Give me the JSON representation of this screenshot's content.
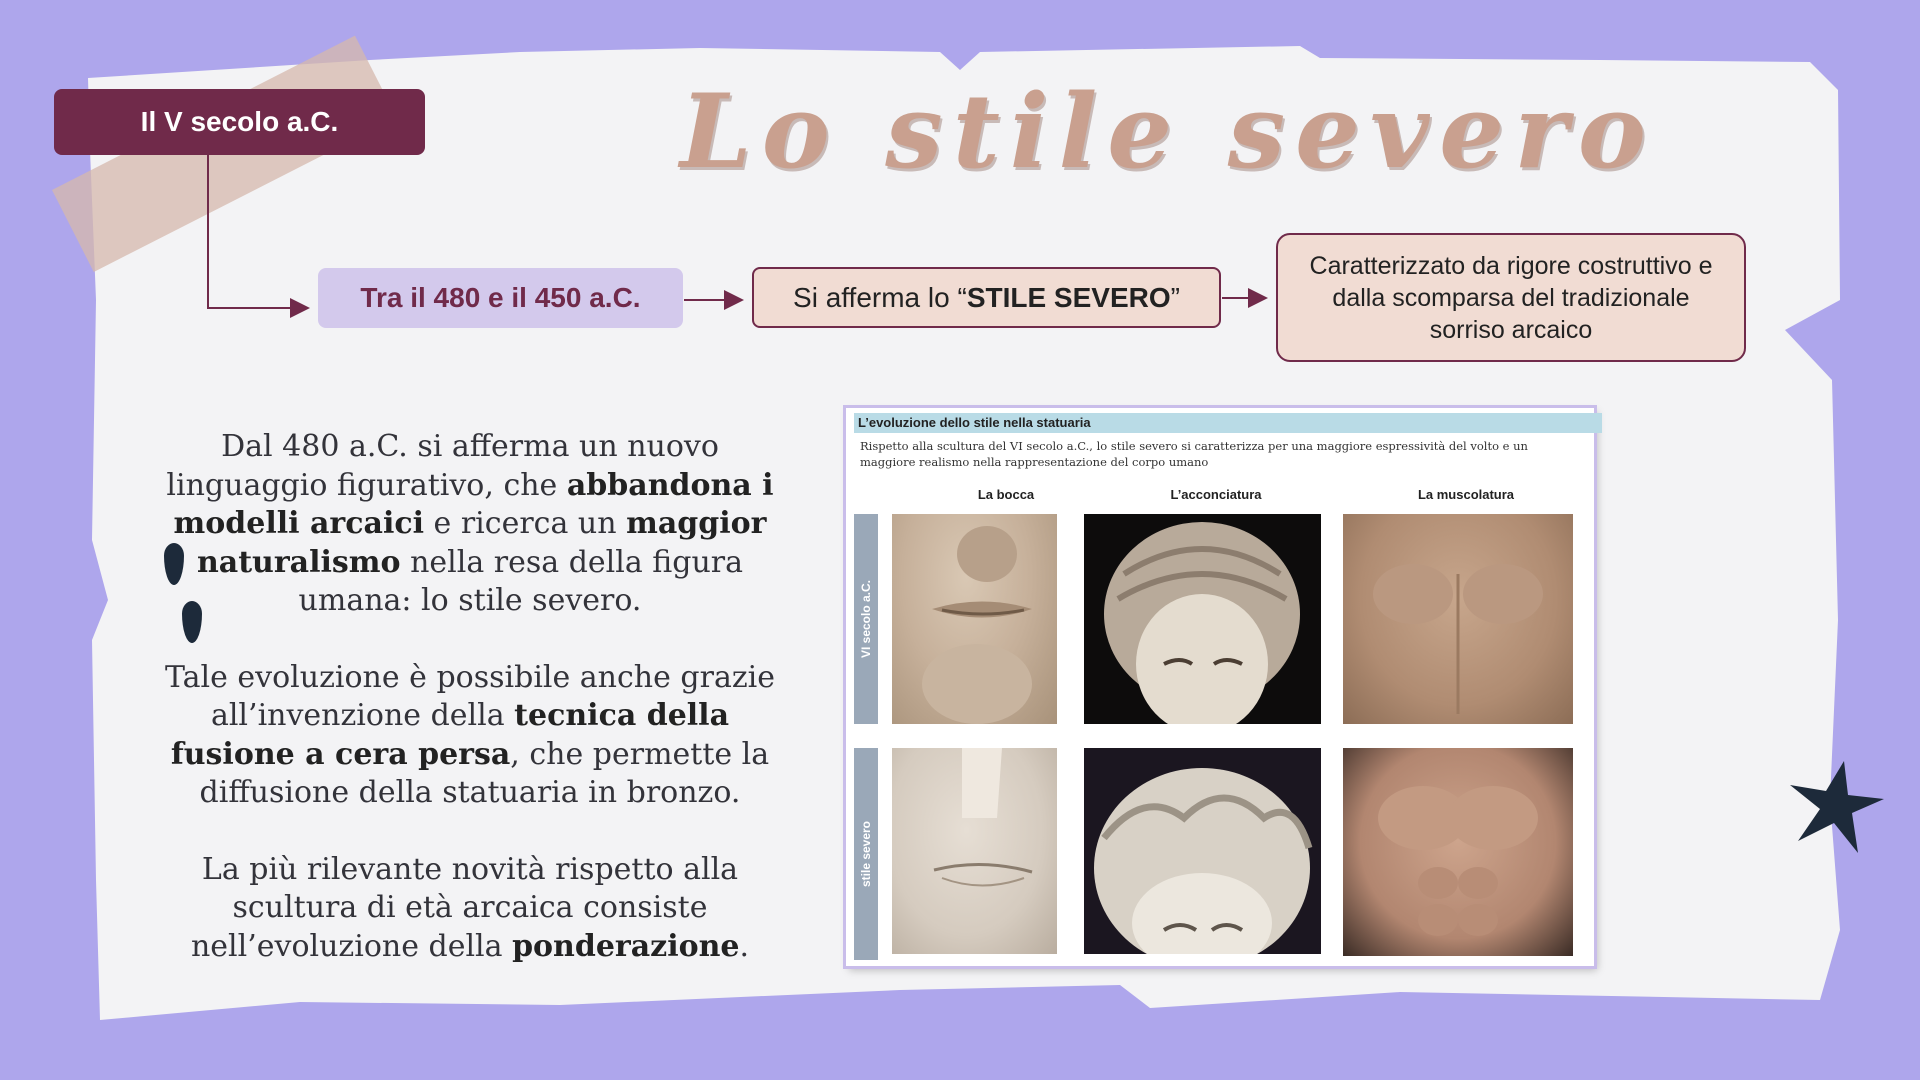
{
  "period_label": "Il V secolo a.C.",
  "title": "Lo stile severo",
  "timeline": {
    "date_range": "Tra il 480 e il 450 a.C.",
    "affirm_prefix": "Si afferma lo “",
    "affirm_bold": "STILE SEVERO",
    "affirm_suffix": "”",
    "description": "Caratterizzato da rigore costruttivo e dalla scomparsa del tradizionale sorriso arcaico"
  },
  "paragraphs": [
    {
      "parts": [
        {
          "text": "Dal 480 a.C. si afferma un nuovo linguaggio figurativo, che ",
          "bold": false
        },
        {
          "text": "abbandona i modelli arcaici",
          "bold": true
        },
        {
          "text": " e ricerca un ",
          "bold": false
        },
        {
          "text": "maggior naturalismo",
          "bold": true
        },
        {
          "text": " nella resa della figura umana: lo stile severo.",
          "bold": false
        }
      ]
    },
    {
      "parts": [
        {
          "text": "Tale evoluzione è possibile anche grazie all’invenzione della ",
          "bold": false
        },
        {
          "text": "tecnica della fusione a cera persa",
          "bold": true
        },
        {
          "text": ", che permette la diffusione della statuaria in bronzo.",
          "bold": false
        }
      ]
    },
    {
      "parts": [
        {
          "text": "La più rilevante novità rispetto alla scultura di età arcaica consiste nell’evoluzione della ",
          "bold": false
        },
        {
          "text": "ponderazione",
          "bold": true
        },
        {
          "text": ".",
          "bold": false
        }
      ]
    }
  ],
  "figure": {
    "heading": "L’evoluzione dello stile nella statuaria",
    "subtitle": "Rispetto alla scultura del VI secolo a.C., lo stile severo si caratterizza per una maggiore espressività del volto e un maggiore realismo nella rappresentazione del corpo umano",
    "columns": [
      "La bocca",
      "L’acconciatura",
      "La muscolatura"
    ],
    "rows": [
      "VI secolo a.C.",
      "stile severo"
    ]
  },
  "colors": {
    "background": "#aea6ec",
    "paper": "#f3f3f5",
    "accent_dark": "#702a4a",
    "pink_box": "#f1dcd3",
    "lilac_box": "#d3c9ec",
    "title": "#c9a08f",
    "decor_navy": "#1d2a3a"
  },
  "icons": [
    "water-drop-icon",
    "star-icon"
  ]
}
